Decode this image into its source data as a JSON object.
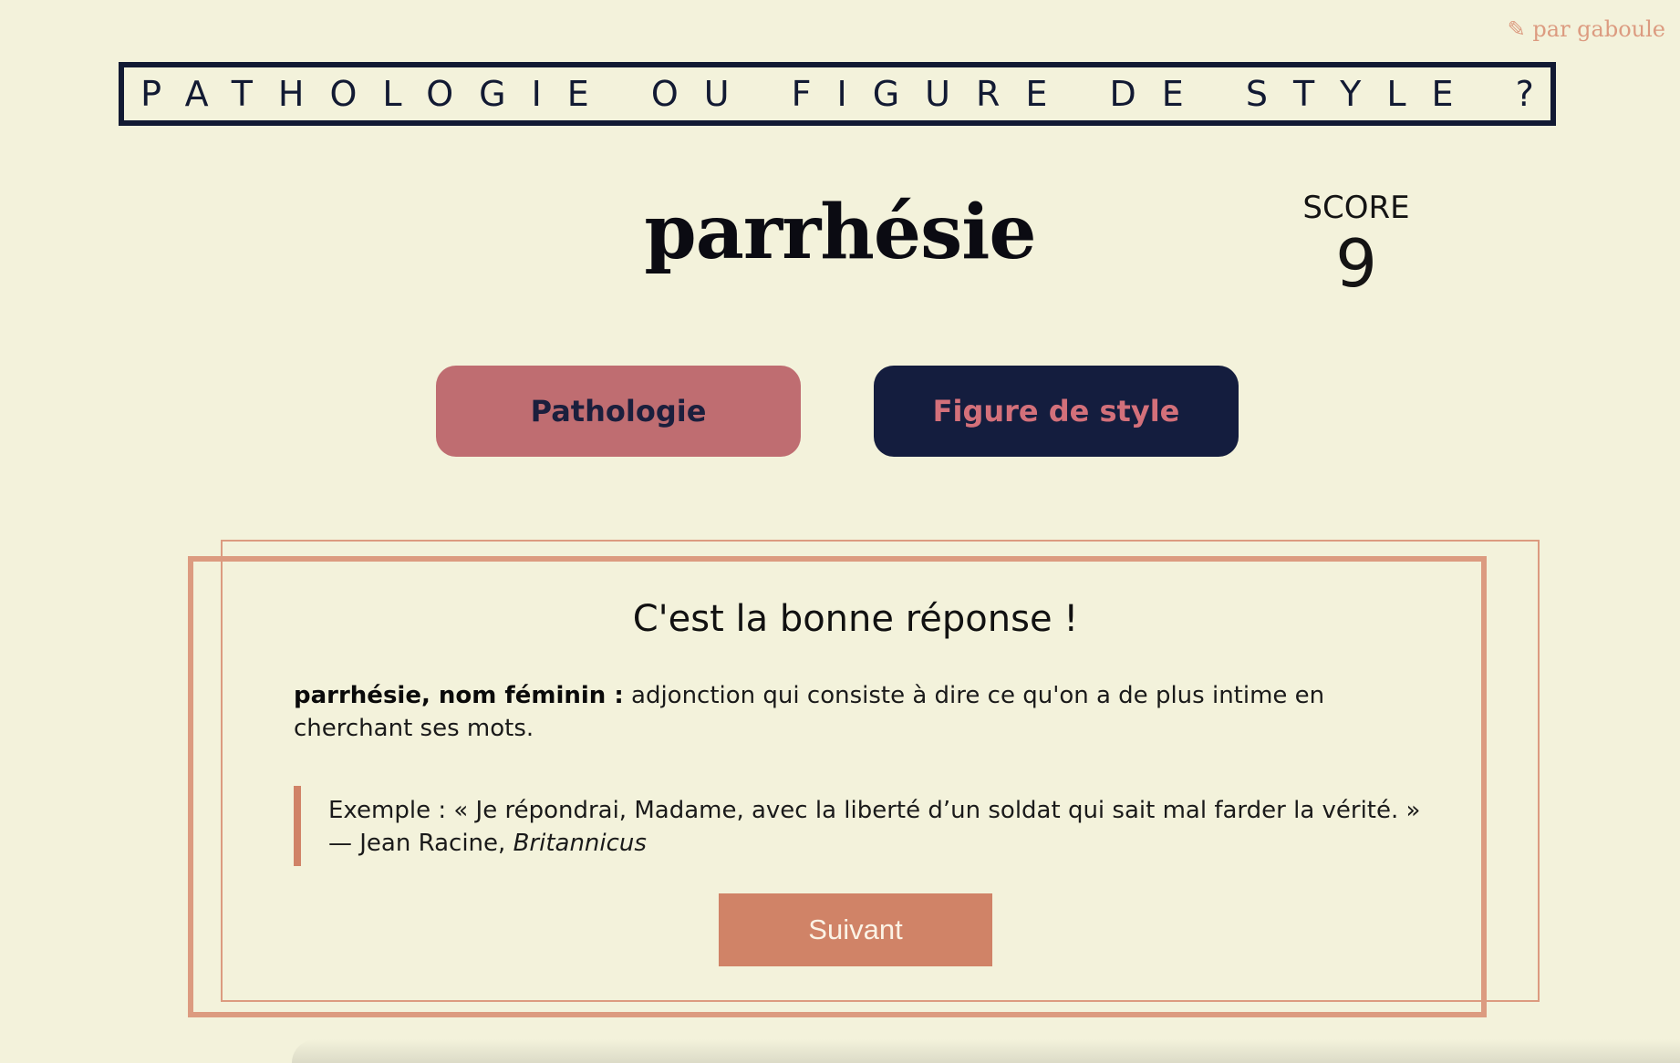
{
  "header": {
    "author_link": "✎ par gaboule",
    "title": "PATHOLOGIE OU FIGURE DE STYLE ?"
  },
  "question": {
    "word": "parrhésie"
  },
  "score": {
    "label": "SCORE",
    "value": "9"
  },
  "choices": {
    "pathologie_label": "Pathologie",
    "figure_label": "Figure de style"
  },
  "result": {
    "verdict": "C'est la bonne réponse !",
    "definition_term": "parrhésie, nom féminin :",
    "definition_text": " adjonction qui consiste à dire ce qu'on a de plus intime en cherchant ses mots.",
    "example_quote": "Exemple : « Je répondrai, Madame, avec la liberté d’un soldat qui sait mal farder la vérité. »",
    "example_author": "— Jean Racine, ",
    "example_work": "Britannicus",
    "next_label": "Suivant"
  },
  "colors": {
    "background": "#f3f2db",
    "navy": "#121a33",
    "rose": "#bf6d71",
    "terracotta": "#d08367",
    "peach_border": "#dc9b80"
  }
}
